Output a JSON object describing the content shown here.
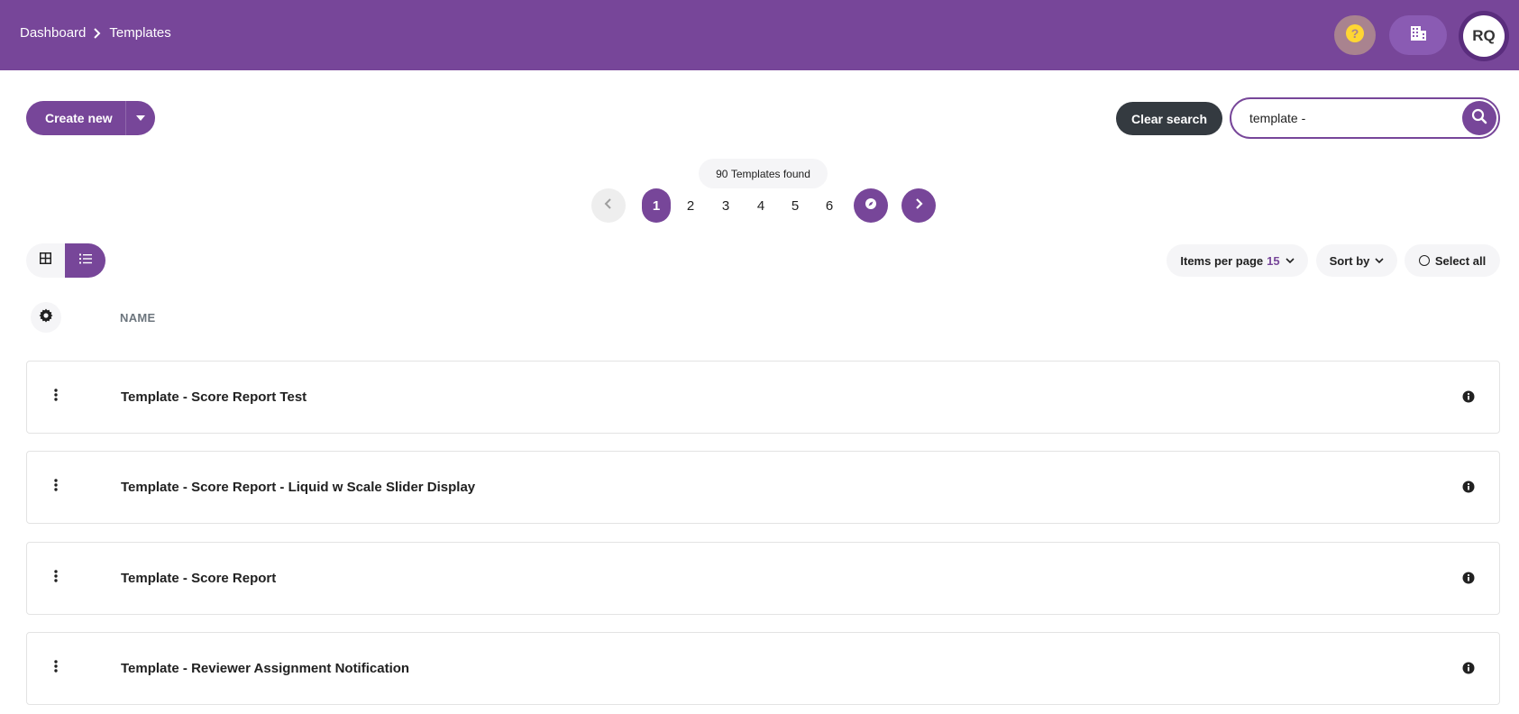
{
  "breadcrumb": {
    "items": [
      "Dashboard",
      "Templates"
    ]
  },
  "header": {
    "icons": [
      "help-icon",
      "building-icon"
    ],
    "avatar_initials": "RQ",
    "colors": {
      "brand": "#774699",
      "help": "#a9838f",
      "help_glyph": "#ffd633"
    }
  },
  "toolbar": {
    "create_label": "Create new",
    "clear_label": "Clear search",
    "search_value": "template -"
  },
  "results": {
    "count": "90",
    "count_suffix": "Templates found"
  },
  "pagination": {
    "pages": [
      "1",
      "2",
      "3",
      "4",
      "5",
      "6"
    ],
    "current": "1"
  },
  "controls": {
    "items_per_page_label": "Items per page",
    "items_per_page_value": "15",
    "sort_label": "Sort by",
    "select_all_label": "Select all"
  },
  "table": {
    "column_name": "NAME",
    "rows": [
      {
        "name": "Template - Score Report Test"
      },
      {
        "name": "Template - Score Report - Liquid w Scale Slider Display"
      },
      {
        "name": "Template - Score Report"
      },
      {
        "name": "Template - Reviewer Assignment Notification"
      }
    ]
  }
}
